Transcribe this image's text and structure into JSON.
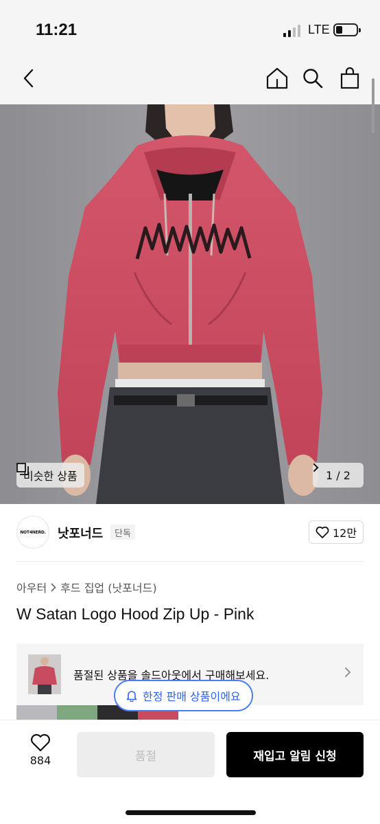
{
  "status": {
    "time": "11:21",
    "network": "LTE"
  },
  "nav": {
    "back_icon": "chevron-left-icon",
    "home_icon": "home-icon",
    "search_icon": "search-icon",
    "cart_icon": "shopping-bag-icon"
  },
  "gallery": {
    "similar_label": "비슷한 상품",
    "counter": "1 / 2"
  },
  "brand": {
    "logo_text": "NOT4NERD.",
    "name": "낫포너드",
    "tag": "단독",
    "likes": "12만"
  },
  "breadcrumb": {
    "category": "아우터",
    "subcategory": "후드 집업 (낫포너드)"
  },
  "product": {
    "title": "W Satan Logo Hood Zip Up - Pink"
  },
  "soldout_banner": {
    "text": "품절된 상품을 솔드아웃에서 구매해보세요."
  },
  "tooltip": {
    "text": "한정 판매 상품이에요"
  },
  "actions": {
    "wish_count": "884",
    "soldout_label": "품절",
    "restock_label": "재입고 알림 신청"
  },
  "colors": {
    "hoodie": "#c84a5f",
    "accent_blue": "#2f62e8",
    "primary": "#000000"
  }
}
